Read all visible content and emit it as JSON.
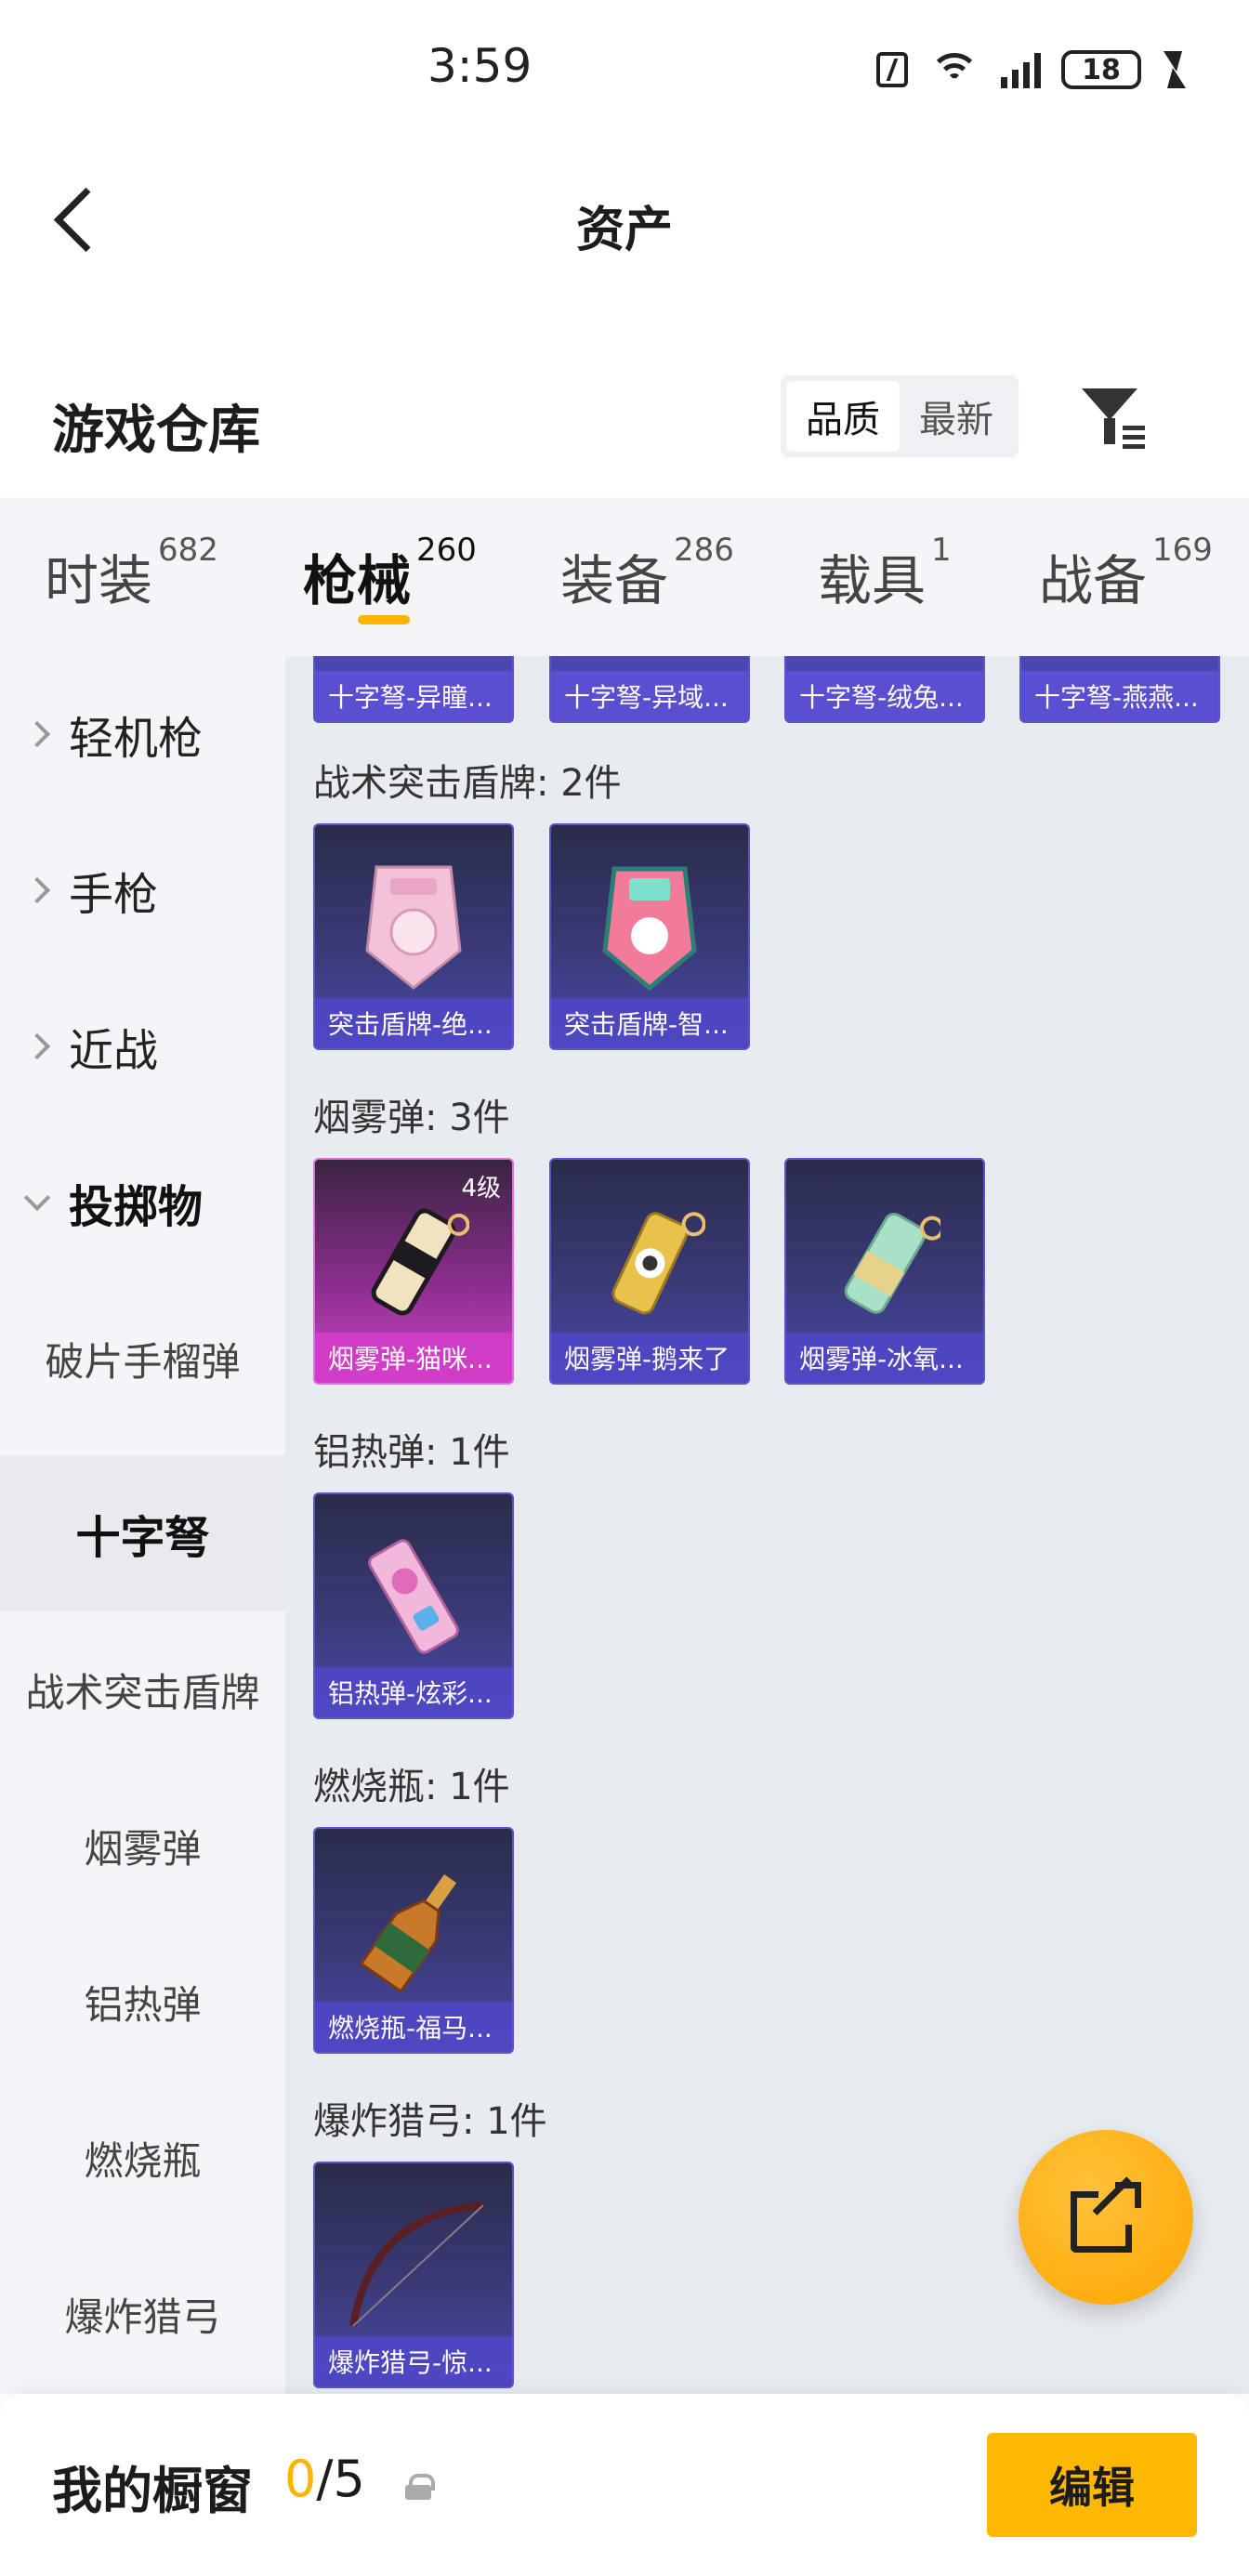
{
  "status_bar": {
    "time": "3:59",
    "battery": "18",
    "network": "4G"
  },
  "header": {
    "title": "资产"
  },
  "warehouse": {
    "title": "游戏仓库",
    "sort_options": [
      "品质",
      "最新"
    ],
    "sort_active": "品质"
  },
  "tabs": [
    {
      "label": "时装",
      "count": "682"
    },
    {
      "label": "枪械",
      "count": "260"
    },
    {
      "label": "装备",
      "count": "286"
    },
    {
      "label": "载具",
      "count": "1"
    },
    {
      "label": "战备",
      "count": "169"
    }
  ],
  "active_tab": "枪械",
  "sidebar": {
    "categories": [
      {
        "label": "轻机枪"
      },
      {
        "label": "手枪"
      },
      {
        "label": "近战"
      },
      {
        "label": "投掷物"
      }
    ],
    "subitems": [
      {
        "label": "破片手榴弹"
      },
      {
        "label": "十字弩"
      },
      {
        "label": "战术突击盾牌"
      },
      {
        "label": "烟雾弹"
      },
      {
        "label": "铝热弹"
      },
      {
        "label": "燃烧瓶"
      },
      {
        "label": "爆炸猎弓"
      }
    ],
    "selected": "十字弩"
  },
  "content": {
    "partial_row": [
      "十字弩-异瞳...",
      "十字弩-异域...",
      "十字弩-绒兔...",
      "十字弩-燕燕..."
    ],
    "groups": [
      {
        "title": "战术突击盾牌: 2件",
        "items": [
          {
            "label": "突击盾牌-绝...",
            "level": ""
          },
          {
            "label": "突击盾牌-智...",
            "level": ""
          }
        ]
      },
      {
        "title": "烟雾弹: 3件",
        "items": [
          {
            "label": "烟雾弹-猫咪...",
            "level": "4级"
          },
          {
            "label": "烟雾弹-鹅来了",
            "level": ""
          },
          {
            "label": "烟雾弹-冰氧...",
            "level": ""
          }
        ]
      },
      {
        "title": "铝热弹: 1件",
        "items": [
          {
            "label": "铝热弹-炫彩...",
            "level": ""
          }
        ]
      },
      {
        "title": "燃烧瓶: 1件",
        "items": [
          {
            "label": "燃烧瓶-福马...",
            "level": ""
          }
        ]
      },
      {
        "title": "爆炸猎弓: 1件",
        "items": [
          {
            "label": "爆炸猎弓-惊...",
            "level": ""
          }
        ]
      }
    ]
  },
  "bottom_bar": {
    "label": "我的橱窗",
    "count_current": "0",
    "count_total": "/5",
    "edit_label": "编辑"
  },
  "colors": {
    "accent": "#ffb400",
    "card_blue": "#4b49a8",
    "card_purple": "#d04ac8"
  },
  "icons": [
    "back-arrow-icon",
    "filter-icon",
    "share-icon",
    "lock-icon",
    "chevron-right-icon",
    "chevron-down-icon"
  ]
}
